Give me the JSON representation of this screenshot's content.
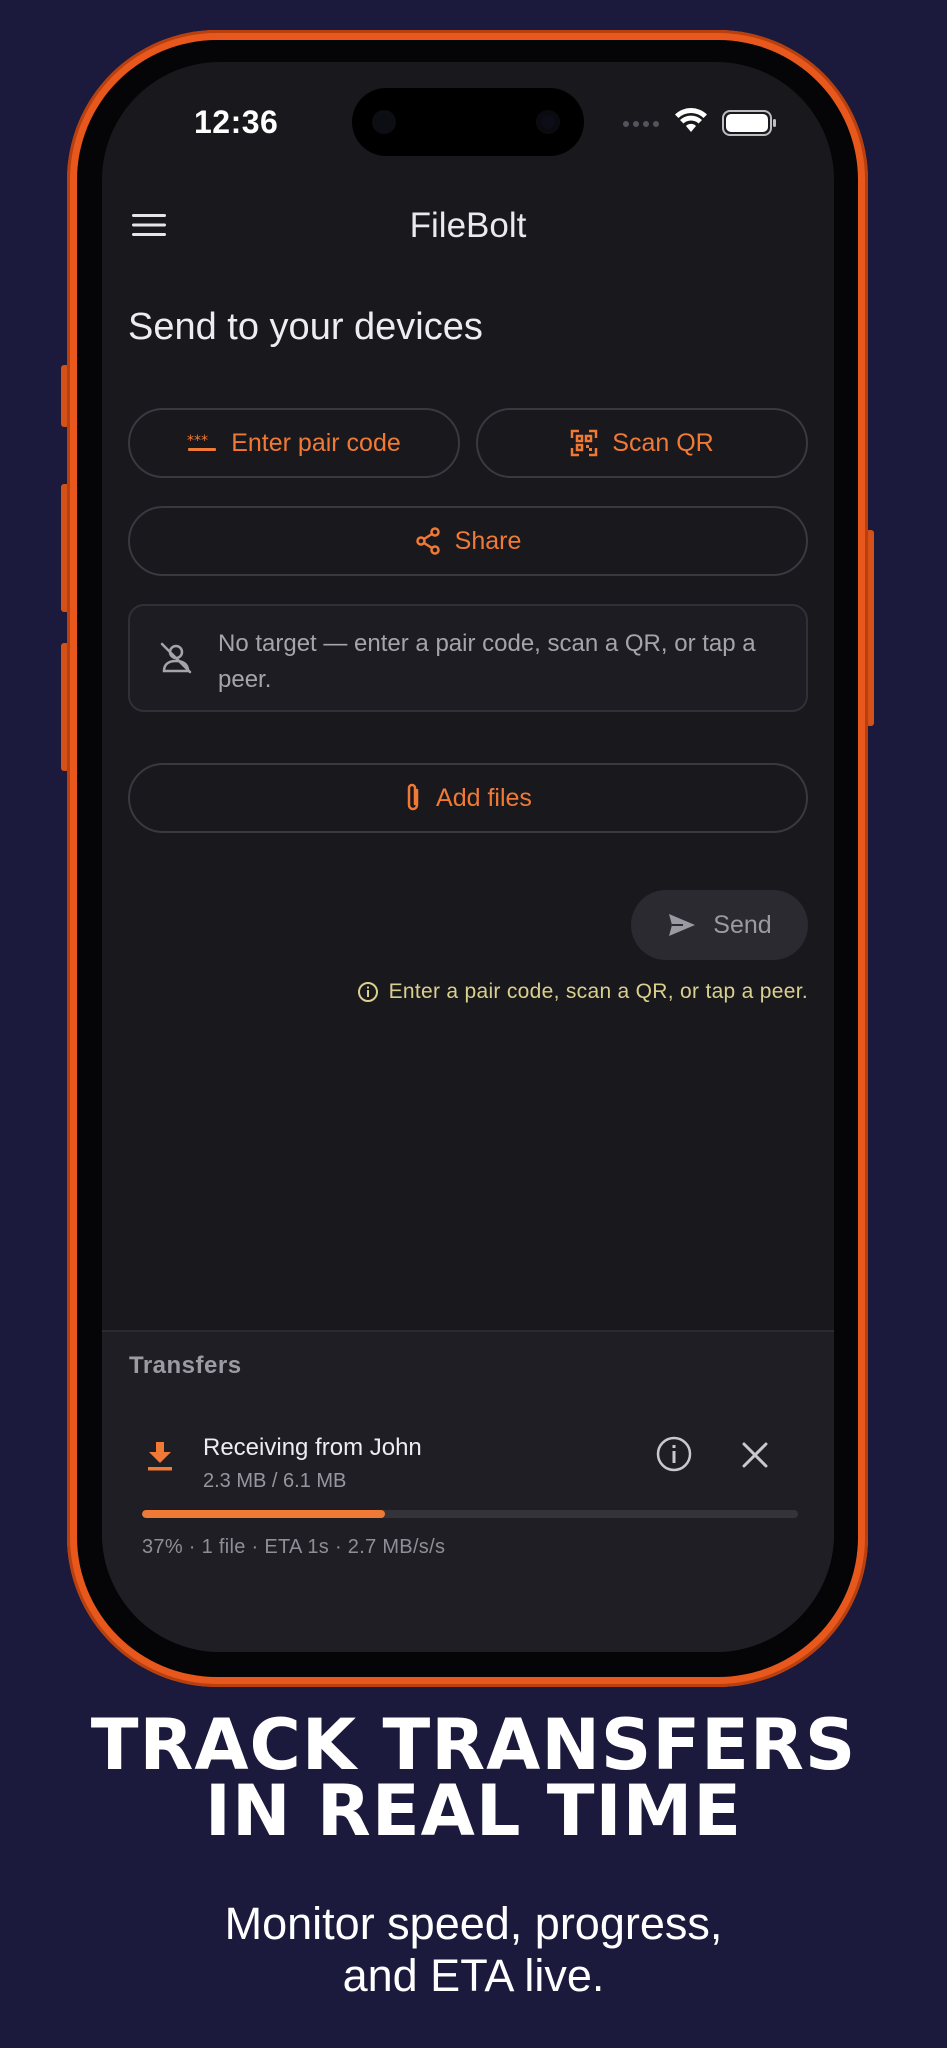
{
  "status_bar": {
    "time": "12:36"
  },
  "app_bar": {
    "title": "FileBolt"
  },
  "main": {
    "heading": "Send to your devices",
    "pair_code_label": "Enter pair code",
    "scan_qr_label": "Scan QR",
    "share_label": "Share",
    "target_message": "No target — enter a pair code, scan a QR, or tap a peer.",
    "add_files_label": "Add files",
    "send_label": "Send",
    "hint": "Enter a pair code, scan a QR, or tap a peer."
  },
  "transfers": {
    "label": "Transfers",
    "item": {
      "title": "Receiving from John",
      "size": "2.3 MB / 6.1 MB",
      "progress": 0.37,
      "stats": "37% · 1 file · ETA 1s · 2.7 MB/s/s"
    }
  },
  "marketing": {
    "headline_line1": "TRACK TRANSFERS",
    "headline_line2": "IN REAL TIME",
    "sub_line1": "Monitor speed, progress,",
    "sub_line2": "and ETA live."
  },
  "colors": {
    "accent": "#f07a35",
    "frame": "#e8581d",
    "background": "#1b1a3d",
    "hint": "#d9d08e"
  }
}
